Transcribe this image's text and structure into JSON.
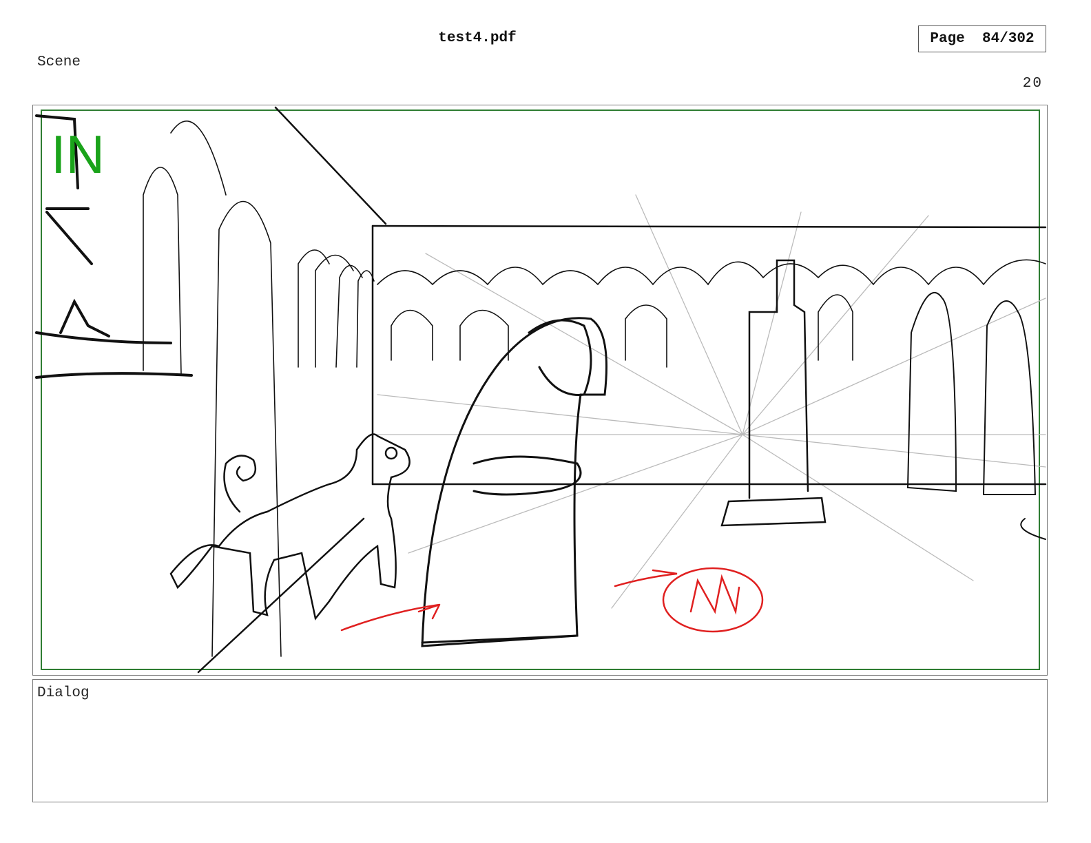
{
  "header": {
    "file_title": "test4.pdf",
    "page_label": "Page",
    "page_current": "84",
    "page_total": "302",
    "page_text": "Page  84/302"
  },
  "scene": {
    "label": "Scene",
    "number": "20"
  },
  "panel": {
    "marker": "IN",
    "marker_color": "#1aa31a",
    "frame_color": "#2e7d32",
    "annotation_color": "#e02020"
  },
  "dialog": {
    "label": "Dialog",
    "text": ""
  }
}
